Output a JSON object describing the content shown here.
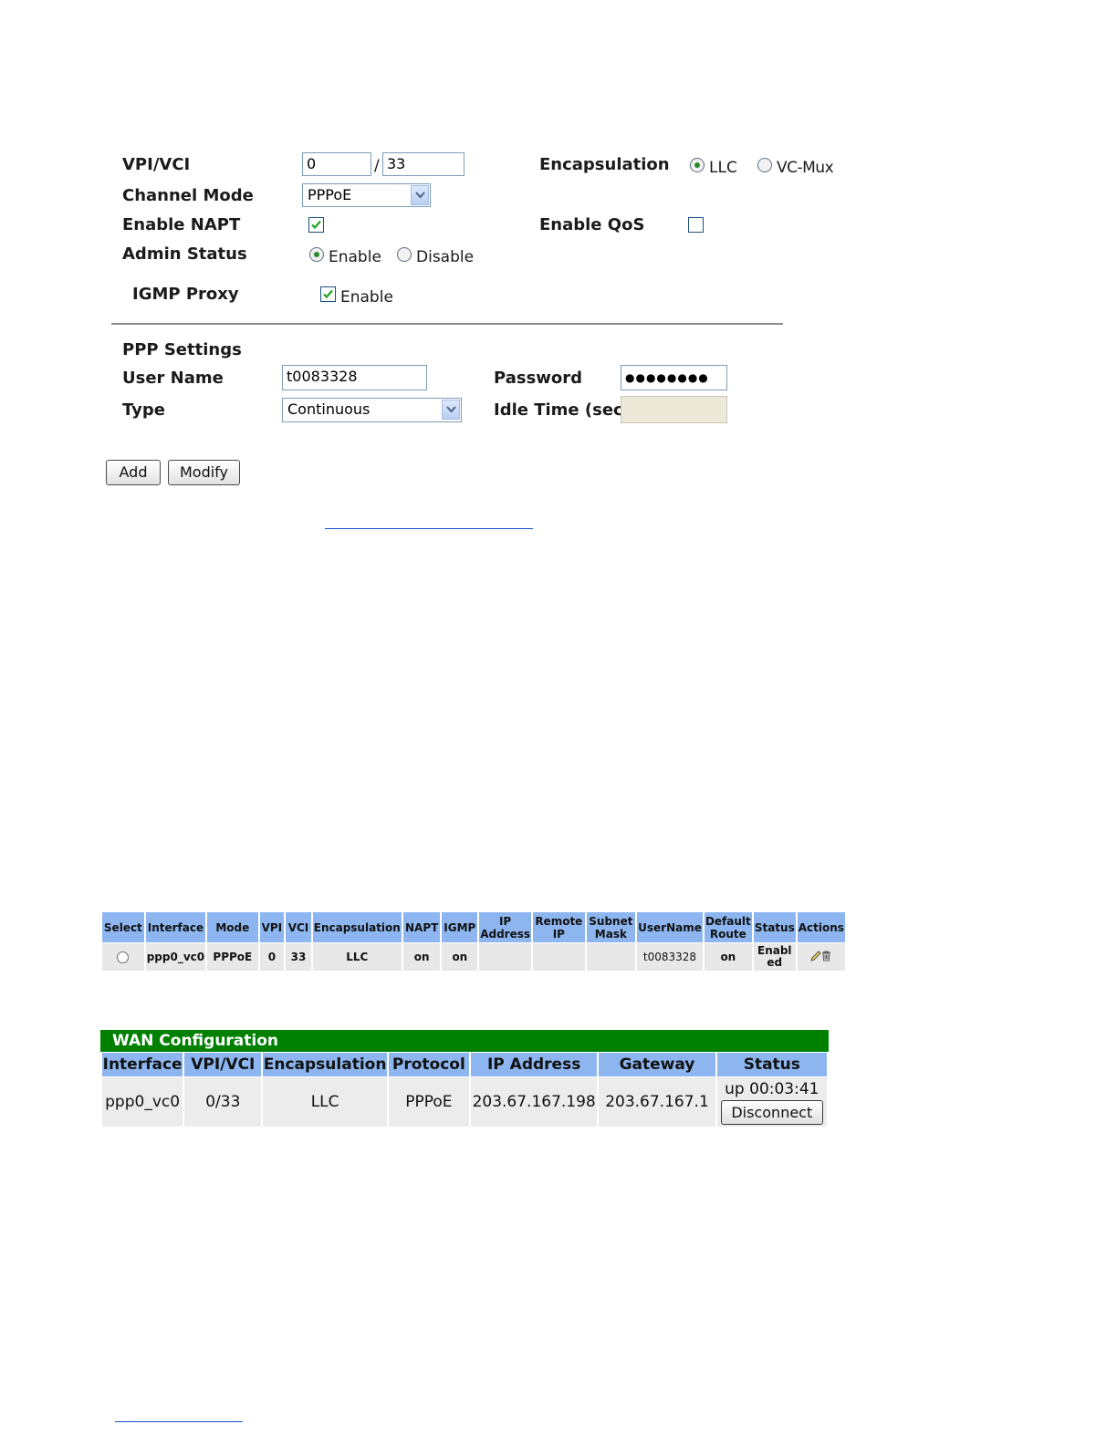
{
  "form": {
    "vpi_vci_label": "VPI/VCI",
    "vpi_value": "0",
    "vci_separator": "/",
    "vci_value": "33",
    "encapsulation_label": "Encapsulation",
    "encap_llc": "LLC",
    "encap_vcmux": "VC-Mux",
    "encap_selected": "LLC",
    "channel_mode_label": "Channel Mode",
    "channel_mode_value": "PPPoE",
    "enable_napt_label": "Enable NAPT",
    "enable_napt_checked": true,
    "enable_qos_label": "Enable QoS",
    "enable_qos_checked": false,
    "admin_status_label": "Admin Status",
    "admin_enable": "Enable",
    "admin_disable": "Disable",
    "admin_selected": "Enable",
    "igmp_proxy_label": "IGMP Proxy",
    "igmp_enable": "Enable",
    "igmp_checked": true
  },
  "ppp": {
    "section_title": "PPP Settings",
    "username_label": "User Name",
    "username_value": "t0083328",
    "password_label": "Password",
    "password_value": "●●●●●●●●",
    "type_label": "Type",
    "type_value": "Continuous",
    "idle_time_label": "Idle Time (sec)",
    "idle_time_value": ""
  },
  "buttons": {
    "add": "Add",
    "modify": "Modify"
  },
  "atm_table": {
    "headers": [
      "Select",
      "Interface",
      "Mode",
      "VPI",
      "VCI",
      "Encapsulation",
      "NAPT",
      "IGMP",
      "IP Address",
      "Remote IP",
      "Subnet Mask",
      "UserName",
      "Default Route",
      "Status",
      "Actions"
    ],
    "row": {
      "interface": "ppp0_vc0",
      "mode": "PPPoE",
      "vpi": "0",
      "vci": "33",
      "encapsulation": "LLC",
      "napt": "on",
      "igmp": "on",
      "ip_address": "",
      "remote_ip": "",
      "subnet_mask": "",
      "username": "t0083328",
      "default_route": "on",
      "status": "Enabled"
    }
  },
  "wan_table": {
    "title": "WAN Configuration",
    "headers": [
      "Interface",
      "VPI/VCI",
      "Encapsulation",
      "Protocol",
      "IP Address",
      "Gateway",
      "Status"
    ],
    "row": {
      "interface": "ppp0_vc0",
      "vpi_vci": "0/33",
      "encapsulation": "LLC",
      "protocol": "PPPoE",
      "ip_address": "203.67.167.198",
      "gateway": "203.67.167.1",
      "status": "up 00:03:41",
      "disconnect": "Disconnect"
    }
  },
  "colors": {
    "header_blue": "#8db6f0",
    "wan_green": "#008000",
    "row_gray": "#e8e8e8",
    "link_blue": "#1a4fd0"
  }
}
